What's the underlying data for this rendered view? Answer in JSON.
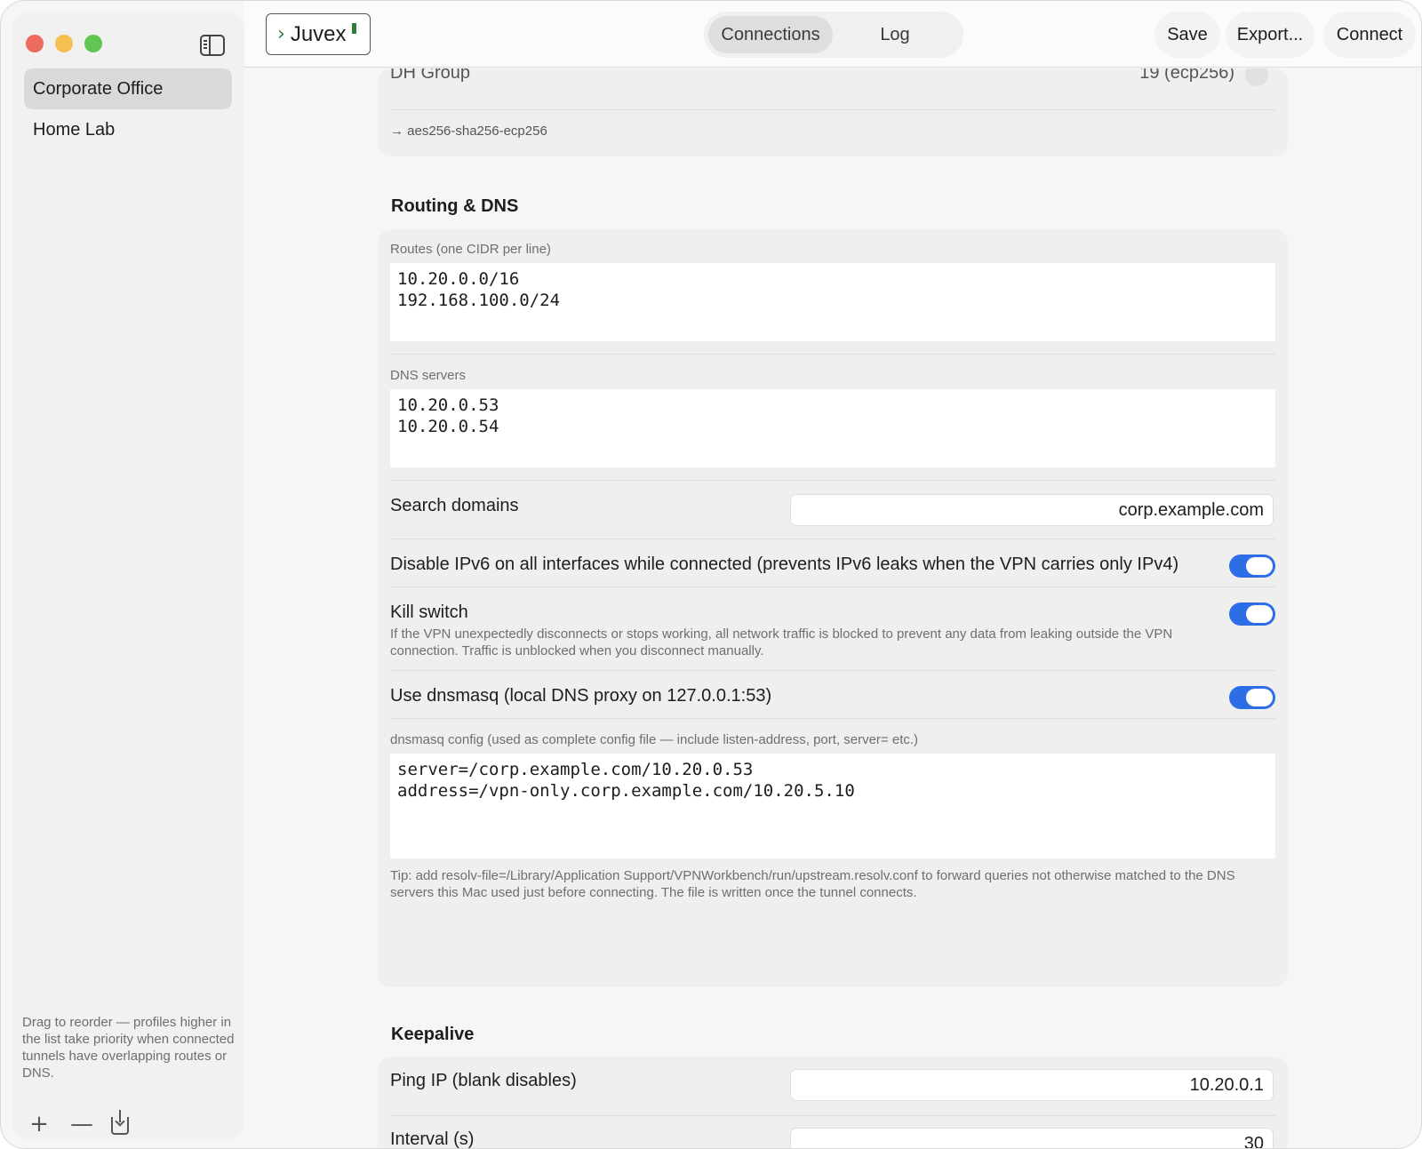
{
  "sidebar": {
    "profiles": [
      {
        "label": "Corporate Office",
        "selected": true
      },
      {
        "label": "Home Lab",
        "selected": false
      }
    ],
    "hint": "Drag to reorder — profiles higher in the list take priority when connected tunnels have overlapping routes or DNS."
  },
  "toolbar": {
    "logo_text": "Juvex",
    "tabs": [
      "Connections",
      "Log"
    ],
    "save_label": "Save",
    "export_label": "Export...",
    "connect_label": "Connect"
  },
  "crypto": {
    "partial_label": "DH Group",
    "partial_value": "19 (ecp256)",
    "proposal": "→ aes256-sha256-ecp256"
  },
  "routing": {
    "title": "Routing & DNS",
    "routes_label": "Routes (one CIDR per line)",
    "routes_value": "10.20.0.0/16\n192.168.100.0/24",
    "dns_label": "DNS servers",
    "dns_value": "10.20.0.53\n10.20.0.54",
    "search_domains_label": "Search domains",
    "search_domains_value": "corp.example.com",
    "ipv6_label": "Disable IPv6 on all interfaces while connected (prevents IPv6 leaks when the VPN carries only IPv4)",
    "kill_switch_label": "Kill switch",
    "kill_switch_desc": "If the VPN unexpectedly disconnects or stops working, all network traffic is blocked to prevent any data from leaking outside the VPN connection. Traffic is unblocked when you disconnect manually.",
    "dnsmasq_label": "Use dnsmasq (local DNS proxy on 127.0.0.1:53)",
    "dnsmasq_config_label": "dnsmasq config (used as complete config file — include listen-address, port, server= etc.)",
    "dnsmasq_config_value": "server=/corp.example.com/10.20.0.53\naddress=/vpn-only.corp.example.com/10.20.5.10",
    "tip": "Tip: add resolv-file=/Library/Application Support/VPNWorkbench/run/upstream.resolv.conf to forward queries not otherwise matched to the DNS servers this Mac used just before connecting. The file is written once the tunnel connects."
  },
  "keepalive": {
    "title": "Keepalive",
    "ping_label": "Ping IP (blank disables)",
    "ping_value": "10.20.0.1",
    "interval_label": "Interval (s)",
    "interval_value": "30"
  },
  "colors": {
    "accent": "#2d6ee6",
    "logo_green": "#2d7d3a"
  }
}
